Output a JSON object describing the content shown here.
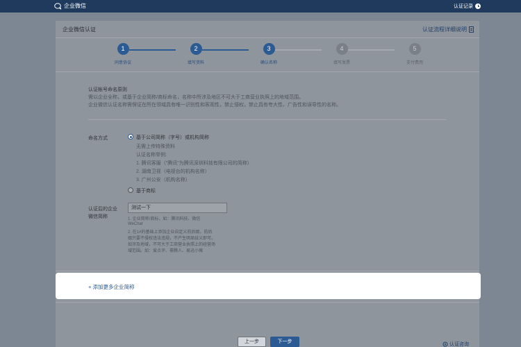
{
  "topbar": {
    "logo_text": "企业微信",
    "auth_record": "认证记录"
  },
  "panel": {
    "title": "企业微信认证",
    "flow_link": "认证流程详细说明"
  },
  "steps": [
    {
      "num": "1",
      "label": "同意协议",
      "status": "done"
    },
    {
      "num": "2",
      "label": "填写资料",
      "status": "done"
    },
    {
      "num": "3",
      "label": "确认名称",
      "status": "done"
    },
    {
      "num": "4",
      "label": "填写发票",
      "status": "todo"
    },
    {
      "num": "5",
      "label": "支付费用",
      "status": "todo"
    }
  ],
  "rules": {
    "title": "认证帐号命名原则",
    "line1": "需以企业全称，或基于企业简称/商标命名，名称中所涉及地区不可大于工商营业执照上的地域范围。",
    "line2": "企业微信认证名称需保证在所在领域具有唯一识别性和客观性，禁止侵权，禁止具有夸大性、广告性和误导性的名称。"
  },
  "naming": {
    "label": "命名方式",
    "option1": "基于公司简称（字号）或机构简称",
    "option1_sub": "无需上传特殊资料",
    "examples_title": "认证名称举例:",
    "example1": "1. 腾讯客服（\"腾讯\"为腾讯深圳科技有限公司的简称）",
    "example2": "2. 湖南卫视（电视台的机构名称）",
    "example3": "3. 广州公安（机构名称）",
    "option2": "基于商标"
  },
  "name_field": {
    "label_line1": "认证后的企业",
    "label_line2": "微信简称",
    "value": "测试一下",
    "hint1": "1. 企业简称/商标，如：腾讯科技、微信",
    "hint1b": "WeChat",
    "hint2": "2. 在1#的基础上添加企业自定义前后缀，前后",
    "hint3": "缀只要不侵权违法违规，不产生明显歧义即可。",
    "hint4": "如涉及地域，不可大于工商营业执照上的经营场",
    "hint5": "域范围。如：爱点评、豪腾人、易迅小薇"
  },
  "add_more": "+ 添加更多企业简称",
  "buttons": {
    "prev": "上一步",
    "next": "下一步"
  },
  "consult": "认证咨询",
  "colors": {
    "topbar": "#1f3a5c",
    "accent": "#2c5a93",
    "overlay": "#7d8794"
  }
}
